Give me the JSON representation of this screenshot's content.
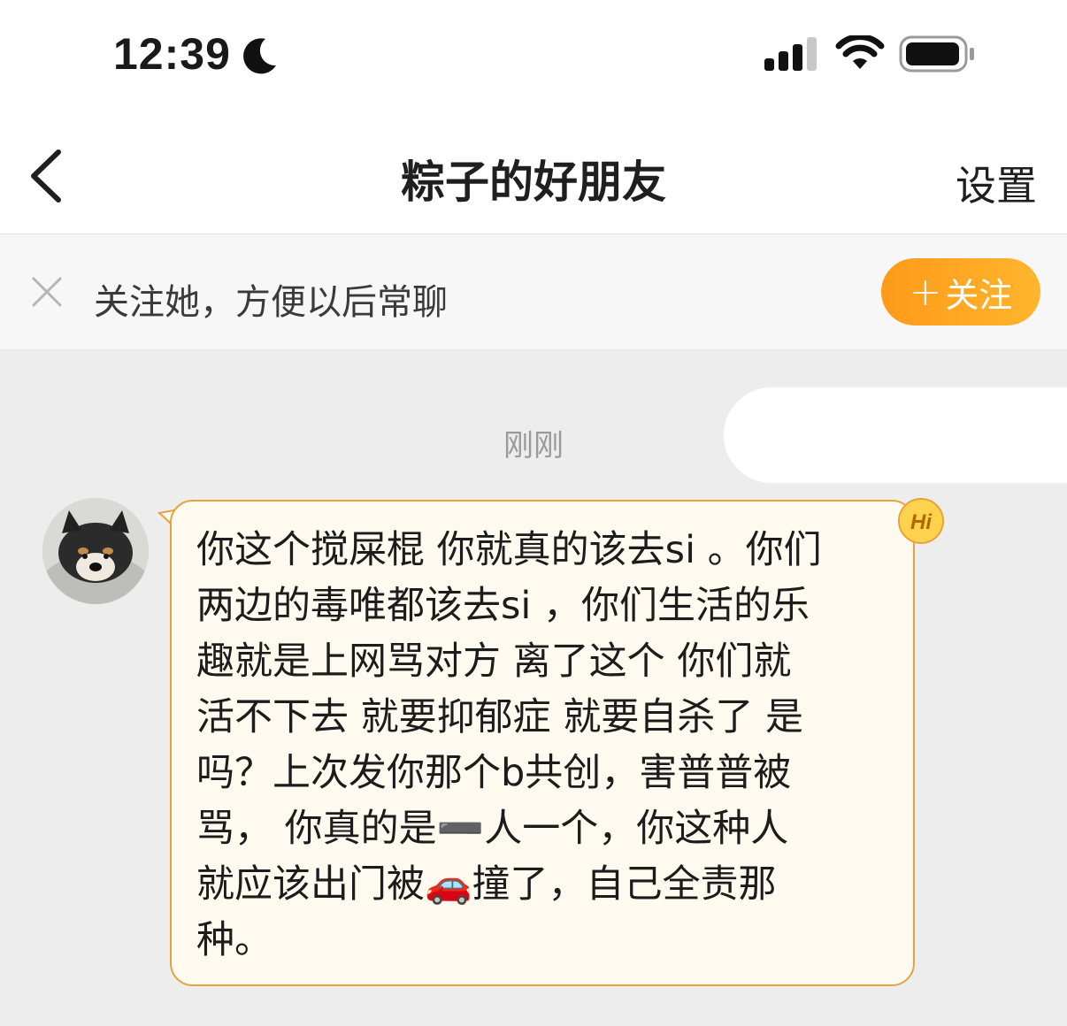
{
  "status_bar": {
    "time": "12:39",
    "icons": [
      "moon-icon",
      "cellular-signal-icon",
      "wifi-icon",
      "battery-icon"
    ]
  },
  "nav": {
    "title": "粽子的好朋友",
    "settings_label": "设置",
    "back_icon": "chevron-left-icon"
  },
  "follow_banner": {
    "text": "关注她，方便以后常聊",
    "button_label": "关注",
    "button_prefix": "+",
    "close_icon": "close-icon",
    "accent_color": "#ff9f1a"
  },
  "chat": {
    "timestamp": "刚刚",
    "badge": "Hi",
    "received_message": "你这个搅屎棍 你就真的该去si 。你们\n两边的毒唯都该去si ，你们生活的乐\n趣就是上网骂对方 离了这个 你们就\n活不下去 就要抑郁症 就要自杀了 是\n吗？上次发你那个b共创，害普普被\n骂， 你真的是➖人一个，你这种人\n就应该出门被🚗撞了，自己全责那\n种。"
  }
}
